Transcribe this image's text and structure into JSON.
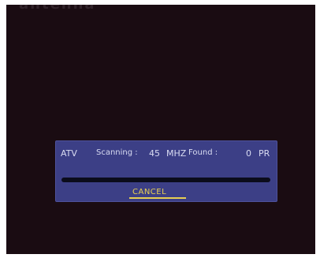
{
  "screen": {
    "top_text": "antenna"
  },
  "scan_dialog": {
    "mode": "ATV",
    "scanning_label": "Scanning :",
    "frequency_value": "45",
    "frequency_unit": "MHZ",
    "found_label": "Found :",
    "found_value": "0",
    "found_unit": "PR",
    "progress_fraction": 0,
    "cancel_label": "CANCEL"
  },
  "colors": {
    "screen_background": "#1a0c12",
    "panel_background": "#3c3f86",
    "progress_track": "#0b0c1c",
    "cancel_accent": "#e8cf52"
  }
}
